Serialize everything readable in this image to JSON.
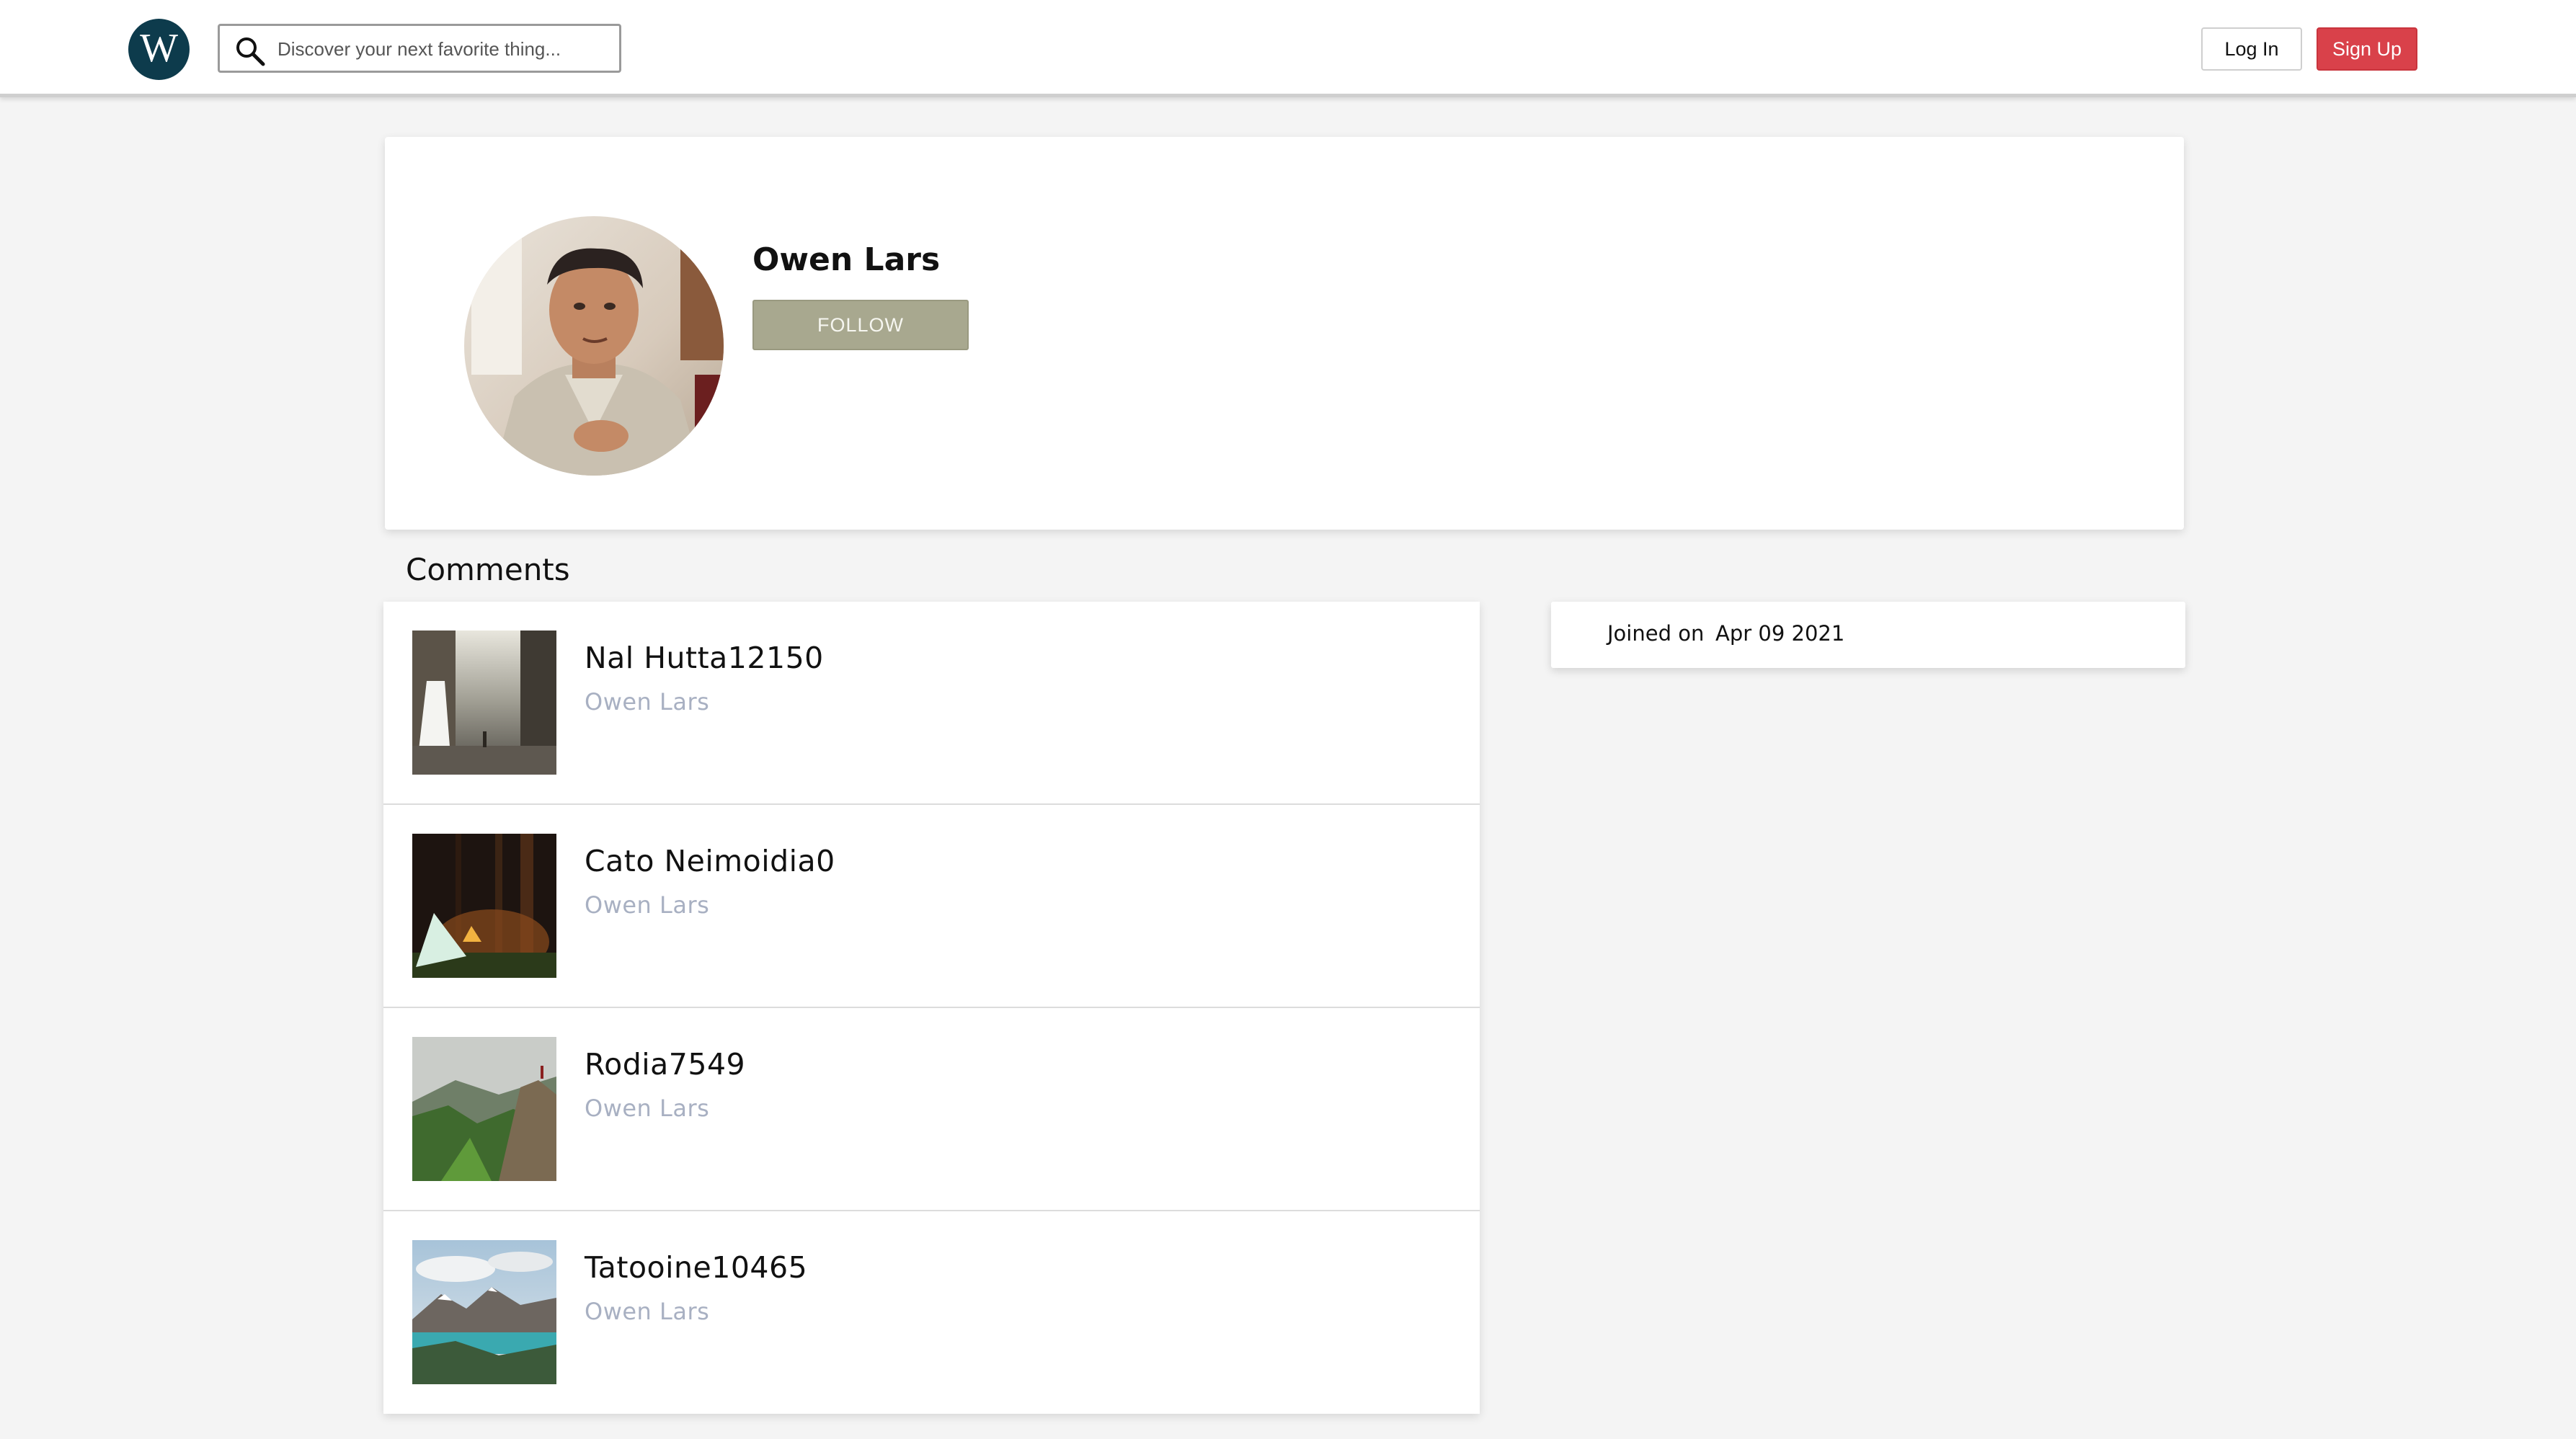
{
  "header": {
    "logo_letter": "W",
    "search": {
      "placeholder": "Discover your next favorite thing..."
    },
    "login_label": "Log In",
    "signup_label": "Sign Up"
  },
  "profile": {
    "name": "Owen Lars",
    "follow_label": "FOLLOW"
  },
  "comments": {
    "heading": "Comments",
    "items": [
      {
        "title": "Nal Hutta12150",
        "author": "Owen Lars",
        "thumb": "waterfall-photo"
      },
      {
        "title": "Cato Neimoidia0",
        "author": "Owen Lars",
        "thumb": "campsite-night-photo"
      },
      {
        "title": "Rodia7549",
        "author": "Owen Lars",
        "thumb": "mountain-cliff-photo"
      },
      {
        "title": "Tatooine10465",
        "author": "Owen Lars",
        "thumb": "mountain-lake-photo"
      }
    ]
  },
  "sidebar": {
    "joined_label": "Joined on",
    "joined_date": "Apr 09 2021"
  },
  "colors": {
    "brand_logo": "#0d3b4c",
    "signup": "#d9414a",
    "follow": "#a8a88f",
    "author_text": "#a8b0c2"
  }
}
